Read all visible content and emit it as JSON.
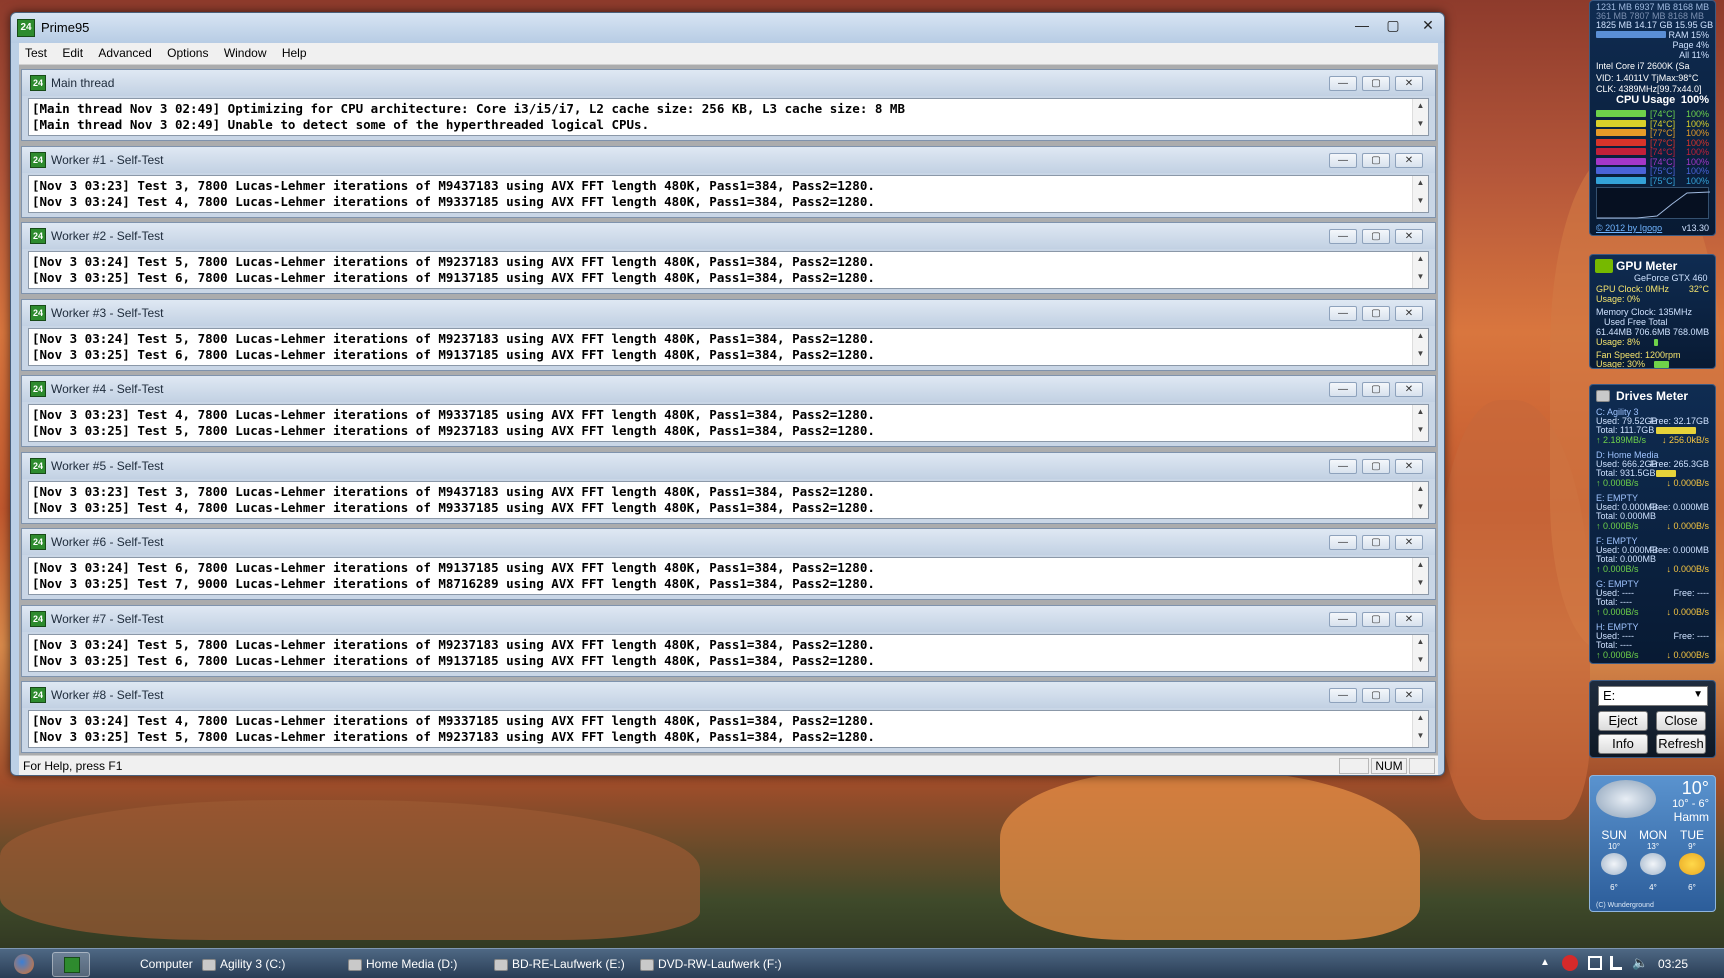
{
  "app": {
    "title": "Prime95",
    "icon_label": "24",
    "menu": [
      "Test",
      "Edit",
      "Advanced",
      "Options",
      "Window",
      "Help"
    ],
    "status": {
      "help": "For Help, press F1",
      "num": "NUM"
    }
  },
  "threads": [
    {
      "name": "Main thread",
      "lines": [
        "[Main thread Nov 3 02:49] Optimizing for CPU architecture: Core i3/i5/i7, L2 cache size: 256 KB, L3 cache size: 8 MB",
        "[Main thread Nov 3 02:49] Unable to detect some of the hyperthreaded logical CPUs."
      ]
    },
    {
      "name": "Worker #1 - Self-Test",
      "lines": [
        "[Nov 3 03:23] Test 3, 7800 Lucas-Lehmer iterations of M9437183 using AVX FFT length 480K, Pass1=384, Pass2=1280.",
        "[Nov 3 03:24] Test 4, 7800 Lucas-Lehmer iterations of M9337185 using AVX FFT length 480K, Pass1=384, Pass2=1280."
      ]
    },
    {
      "name": "Worker #2 - Self-Test",
      "lines": [
        "[Nov 3 03:24] Test 5, 7800 Lucas-Lehmer iterations of M9237183 using AVX FFT length 480K, Pass1=384, Pass2=1280.",
        "[Nov 3 03:25] Test 6, 7800 Lucas-Lehmer iterations of M9137185 using AVX FFT length 480K, Pass1=384, Pass2=1280."
      ]
    },
    {
      "name": "Worker #3 - Self-Test",
      "lines": [
        "[Nov 3 03:24] Test 5, 7800 Lucas-Lehmer iterations of M9237183 using AVX FFT length 480K, Pass1=384, Pass2=1280.",
        "[Nov 3 03:25] Test 6, 7800 Lucas-Lehmer iterations of M9137185 using AVX FFT length 480K, Pass1=384, Pass2=1280."
      ]
    },
    {
      "name": "Worker #4 - Self-Test",
      "lines": [
        "[Nov 3 03:23] Test 4, 7800 Lucas-Lehmer iterations of M9337185 using AVX FFT length 480K, Pass1=384, Pass2=1280.",
        "[Nov 3 03:25] Test 5, 7800 Lucas-Lehmer iterations of M9237183 using AVX FFT length 480K, Pass1=384, Pass2=1280."
      ]
    },
    {
      "name": "Worker #5 - Self-Test",
      "lines": [
        "[Nov 3 03:23] Test 3, 7800 Lucas-Lehmer iterations of M9437183 using AVX FFT length 480K, Pass1=384, Pass2=1280.",
        "[Nov 3 03:25] Test 4, 7800 Lucas-Lehmer iterations of M9337185 using AVX FFT length 480K, Pass1=384, Pass2=1280."
      ]
    },
    {
      "name": "Worker #6 - Self-Test",
      "lines": [
        "[Nov 3 03:24] Test 6, 7800 Lucas-Lehmer iterations of M9137185 using AVX FFT length 480K, Pass1=384, Pass2=1280.",
        "[Nov 3 03:25] Test 7, 9000 Lucas-Lehmer iterations of M8716289 using AVX FFT length 480K, Pass1=384, Pass2=1280."
      ]
    },
    {
      "name": "Worker #7 - Self-Test",
      "lines": [
        "[Nov 3 03:24] Test 5, 7800 Lucas-Lehmer iterations of M9237183 using AVX FFT length 480K, Pass1=384, Pass2=1280.",
        "[Nov 3 03:25] Test 6, 7800 Lucas-Lehmer iterations of M9137185 using AVX FFT length 480K, Pass1=384, Pass2=1280."
      ]
    },
    {
      "name": "Worker #8 - Self-Test",
      "lines": [
        "[Nov 3 03:24] Test 4, 7800 Lucas-Lehmer iterations of M9337185 using AVX FFT length 480K, Pass1=384, Pass2=1280.",
        "[Nov 3 03:25] Test 5, 7800 Lucas-Lehmer iterations of M9237183 using AVX FFT length 480K, Pass1=384, Pass2=1280."
      ]
    }
  ],
  "cpu_meter": {
    "mem_rows": [
      "1231 MB  6937 MB  8168 MB",
      "361 MB  7807 MB  8168 MB",
      "1825 MB  14.17 GB  15.95 GB"
    ],
    "ram": "RAM  15%",
    "page": "Page  4%",
    "all": "All  11%",
    "cpu_name": "Intel Core i7 2600K (Sa",
    "vid": "VID: 1.4011V  TjMax:98°C",
    "clk": "CLK:  4389MHz[99.7x44.0]",
    "usage_label": "CPU Usage",
    "usage_value": "100%",
    "cores": [
      {
        "temp": "[74°C]",
        "pct": "100%",
        "color": "#6fd24a"
      },
      {
        "temp": "[74°C]",
        "pct": "100%",
        "color": "#d8d02a"
      },
      {
        "temp": "[77°C]",
        "pct": "100%",
        "color": "#e59a28"
      },
      {
        "temp": "[77°C]",
        "pct": "100%",
        "color": "#d8342a"
      },
      {
        "temp": "[74°C]",
        "pct": "100%",
        "color": "#c2203a"
      },
      {
        "temp": "[74°C]",
        "pct": "100%",
        "color": "#a437c8"
      },
      {
        "temp": "[75°C]",
        "pct": "100%",
        "color": "#4a63d8"
      },
      {
        "temp": "[75°C]",
        "pct": "100%",
        "color": "#34a2d8"
      }
    ],
    "footer_left": "© 2012 by Igogo",
    "footer_right": "v13.30"
  },
  "gpu_meter": {
    "title": "GPU Meter",
    "model": "GeForce GTX 460",
    "gpu_clock": "GPU Clock: 0MHz",
    "temp": "32°C",
    "usage": "Usage: 0%",
    "mem_clock": "Memory Clock: 135MHz",
    "mem_header": "Used     Free     Total",
    "mem_values": "61.44MB  706.6MB  768.0MB",
    "mem_usage": "Usage: 8%",
    "fan": "Fan Speed: 1200rpm",
    "fan_usage": "Usage: 30%"
  },
  "drives_meter": {
    "title": "Drives Meter",
    "drives": [
      {
        "label": "C: Agility 3",
        "used": "Used: 79.52GB",
        "free": "Free: 32.17GB",
        "total": "Total: 111.7GB",
        "read": "↑ 2.189MB/s",
        "write": "↓ 256.0kB/s"
      },
      {
        "label": "D: Home Media",
        "used": "Used: 666.2GB",
        "free": "Free: 265.3GB",
        "total": "Total: 931.5GB",
        "read": "↑ 0.000B/s",
        "write": "↓ 0.000B/s"
      },
      {
        "label": "E: EMPTY",
        "used": "Used: 0.000MB",
        "free": "Free: 0.000MB",
        "total": "Total: 0.000MB",
        "read": "↑ 0.000B/s",
        "write": "↓ 0.000B/s"
      },
      {
        "label": "F: EMPTY",
        "used": "Used: 0.000MB",
        "free": "Free: 0.000MB",
        "total": "Total: 0.000MB",
        "read": "↑ 0.000B/s",
        "write": "↓ 0.000B/s"
      },
      {
        "label": "G: EMPTY",
        "used": "Used: ----",
        "free": "Free: ----",
        "total": "Total: ----",
        "read": "↑ 0.000B/s",
        "write": "↓ 0.000B/s"
      },
      {
        "label": "H: EMPTY",
        "used": "Used: ----",
        "free": "Free: ----",
        "total": "Total: ----",
        "read": "↑ 0.000B/s",
        "write": "↓ 0.000B/s"
      }
    ]
  },
  "eject_gadget": {
    "drive_value": "E:",
    "eject": "Eject",
    "close": "Close",
    "info": "Info",
    "refresh": "Refresh"
  },
  "weather": {
    "temp": "10°",
    "range": "10° - 6°",
    "city": "Hamm",
    "days": [
      {
        "day": "SUN",
        "hi": "10°",
        "lo": "6°"
      },
      {
        "day": "MON",
        "hi": "13°",
        "lo": "4°"
      },
      {
        "day": "TUE",
        "hi": "9°",
        "lo": "6°"
      }
    ],
    "credit": "(C) Wunderground"
  },
  "taskbar": {
    "items": [
      "Computer",
      "Agility 3 (C:)",
      "Home Media (D:)",
      "BD-RE-Laufwerk (E:)",
      "DVD-RW-Laufwerk (F:)"
    ],
    "clock": "03:25"
  }
}
